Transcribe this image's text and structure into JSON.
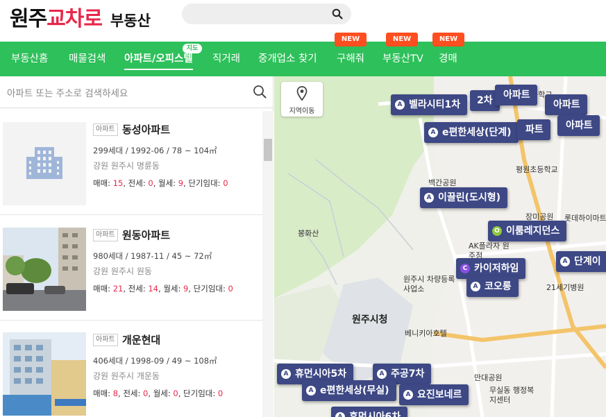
{
  "header": {
    "logo_part1": "원주",
    "logo_part2": "교차로",
    "logo_part3": "부동산",
    "search_value": ""
  },
  "nav": {
    "items": [
      {
        "label": "부동산홈"
      },
      {
        "label": "매물검색"
      },
      {
        "label": "아파트/오피스텔"
      },
      {
        "label": "직거래"
      },
      {
        "label": "중개업소 찾기"
      },
      {
        "label": "구해줘"
      },
      {
        "label": "부동산TV"
      },
      {
        "label": "경매"
      }
    ],
    "active_index": 2,
    "map_chip": "지도",
    "new_badge": "NEW"
  },
  "left": {
    "search_placeholder": "아파트 또는 주소로 검색하세요",
    "listings": [
      {
        "type": "아파트",
        "name": "동성아파트",
        "info": "299세대 / 1992-06 / 78 ~ 104㎡",
        "address": "강원 원주시 명륜동",
        "deal": {
          "sale": "15",
          "jeonse": "0",
          "monthly": "9",
          "short": "0"
        }
      },
      {
        "type": "아파트",
        "name": "원동아파트",
        "info": "980세대 / 1987-11 / 45 ~ 72㎡",
        "address": "강원 원주시 원동",
        "deal": {
          "sale": "21",
          "jeonse": "14",
          "monthly": "9",
          "short": "0"
        }
      },
      {
        "type": "아파트",
        "name": "개운현대",
        "info": "406세대 / 1998-09 / 49 ~ 108㎡",
        "address": "강원 원주시 개운동",
        "deal": {
          "sale": "8",
          "jeonse": "0",
          "monthly": "0",
          "short": "0"
        }
      }
    ],
    "deal_labels": {
      "sale": "매매: ",
      "jeonse": "전세: ",
      "monthly": "월세: ",
      "short": "단기임대: "
    }
  },
  "map": {
    "location_button": "지역이동",
    "markers": [
      {
        "label": "벨라시티1차",
        "badge": "A"
      },
      {
        "label": "2차",
        "badge": ""
      },
      {
        "label": "아파트",
        "badge": ""
      },
      {
        "label": "아파트",
        "badge": ""
      },
      {
        "label": "e편한세상(단계)",
        "badge": "A"
      },
      {
        "label": "파트",
        "badge": ""
      },
      {
        "label": "아파트",
        "badge": ""
      },
      {
        "label": "이끌린(도시형)",
        "badge": "A"
      },
      {
        "label": "이룸레지던스",
        "badge": "O"
      },
      {
        "label": "카이저하임",
        "badge": "C"
      },
      {
        "label": "단계이",
        "badge": "A"
      },
      {
        "label": "코오롱",
        "badge": "A"
      },
      {
        "label": "휴먼시아5차",
        "badge": "A"
      },
      {
        "label": "주공7차",
        "badge": "A"
      },
      {
        "label": "e편한세상(무실)",
        "badge": "A"
      },
      {
        "label": "요진보네르",
        "badge": "A"
      },
      {
        "label": "휴먼시아6차",
        "badge": "A"
      }
    ],
    "places": {
      "city_hall": "원주시청",
      "school": "평원초등학교",
      "park1": "백간공원",
      "park2": "장미공원",
      "mountain": "봉화산",
      "plaza": "AK플라자 원주점",
      "registry": "원주시 차량등록사업소",
      "hotel": "베니키아호텔",
      "park3": "만대공원",
      "welfare": "무실동 행정복지센터",
      "hospital": "21세기병원",
      "lotte": "롯데하이마트",
      "school2": "고등학교"
    }
  }
}
